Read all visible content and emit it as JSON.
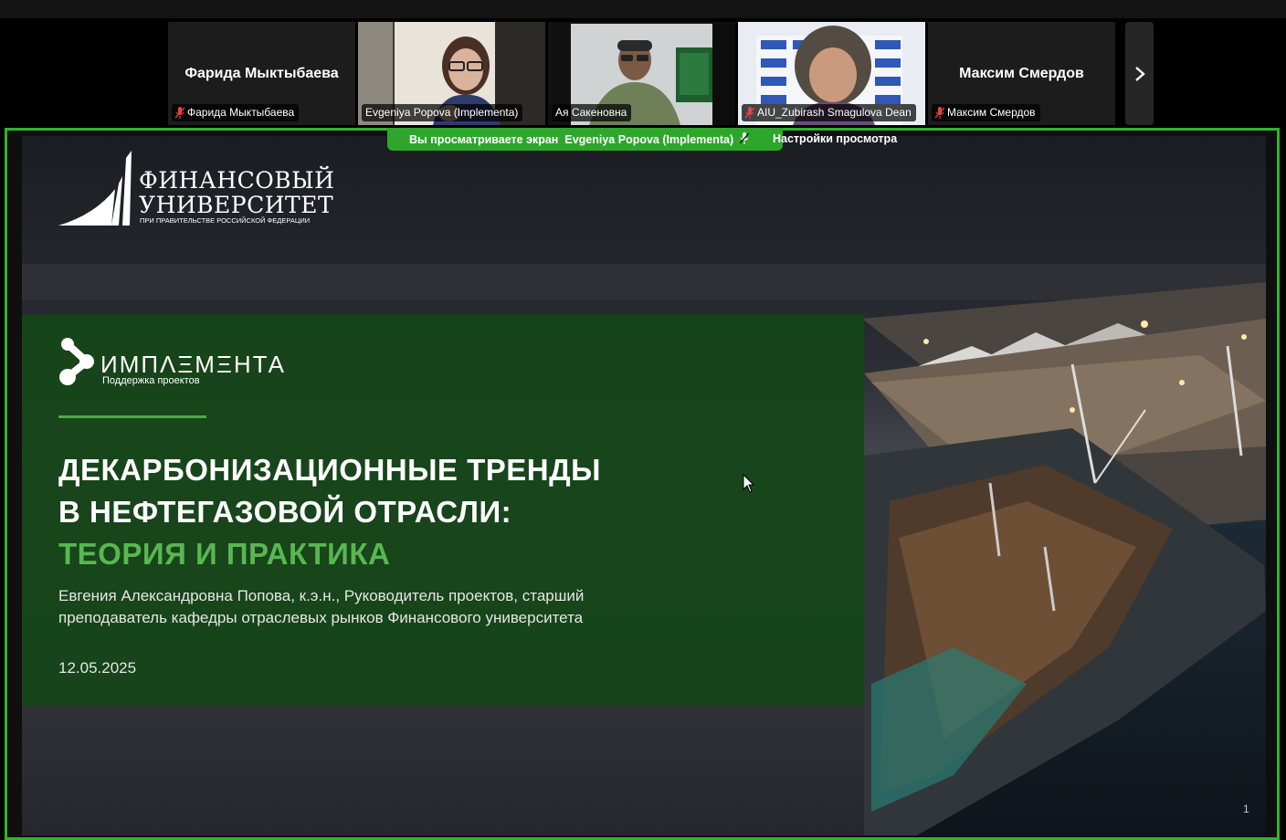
{
  "participants": [
    {
      "name": "Фарида Мыктыбаева",
      "label": "Фарида Мыктыбаева",
      "video": false,
      "muted": true
    },
    {
      "name": "Evgeniya Popova (Implementa)",
      "label": "Evgeniya Popova (Implementa)",
      "video": true,
      "muted": false
    },
    {
      "name": "Ая Сакеновна",
      "label": "Ая Сакеновна",
      "video": true,
      "muted": false,
      "active": true
    },
    {
      "name": "AIU_Zubirash Smagulova Dean",
      "label": "AIU_Zubirash Smagulova Dean",
      "video": true,
      "muted": true
    },
    {
      "name": "Максим Смердов",
      "label": "Максим Смердов",
      "video": false,
      "muted": true
    }
  ],
  "share_banner": {
    "viewing": "Вы просматриваете экран",
    "presenter": "Evgeniya Popova (Implementa)",
    "settings": "Настройки просмотра"
  },
  "slide": {
    "fu_logo_line1": "ФИНАНСОВЫЙ",
    "fu_logo_line2": "УНИВЕРСИТЕТ",
    "fu_logo_line3": "ПРИ ПРАВИТЕЛЬСТВЕ РОССИЙСКОЙ ФЕДЕРАЦИИ",
    "impl_logo": "ИМПΛΞМΞНТА",
    "impl_sub": "Поддержка проектов",
    "title_line1": "ДЕКАРБОНИЗАЦИОННЫЕ ТРЕНДЫ",
    "title_line2": "В НЕФТЕГАЗОВОЙ ОТРАСЛИ:",
    "title_line3": "ТЕОРИЯ И ПРАКТИКА",
    "author_line1": "Евгения Александровна Попова, к.э.н., Руководитель проектов, старший",
    "author_line2": "преподаватель кафедры отраслевых рынков Финансового университета",
    "date": "12.05.2025",
    "page": "1"
  },
  "colors": {
    "share_green": "#2fb42d",
    "panel_green": "#164618",
    "accent_green": "#59b752",
    "active_outline": "#d6e86a"
  }
}
